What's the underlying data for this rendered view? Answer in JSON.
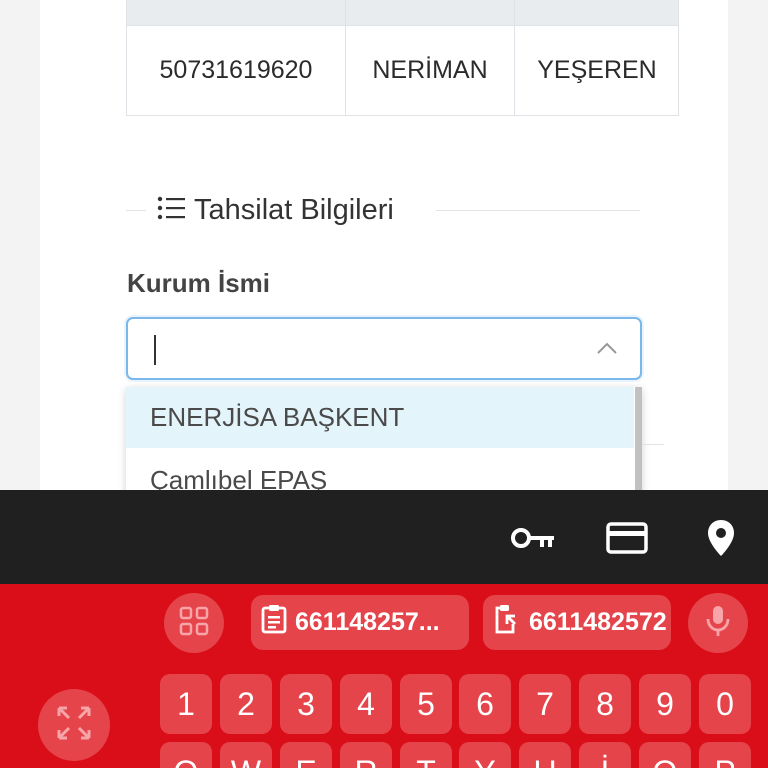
{
  "table": {
    "row": [
      "50731619620",
      "NERİMAN",
      "YEŞEREN"
    ]
  },
  "section": {
    "title": "Tahsilat Bilgileri",
    "icon": "list-icon"
  },
  "form": {
    "label": "Kurum İsmi",
    "value": "",
    "options": [
      "ENERJİSA BAŞKENT",
      "Çamlıbel EPAŞ"
    ],
    "highlighted_option": "ENERJİSA BAŞKENT"
  },
  "keyboard_toolbar": {
    "icons": [
      "key-icon",
      "credit-card-icon",
      "location-pin-icon"
    ]
  },
  "keyboard": {
    "clipboard": [
      "661148257...",
      "6611482572"
    ],
    "number_row": [
      "1",
      "2",
      "3",
      "4",
      "5",
      "6",
      "7",
      "8",
      "9",
      "0"
    ],
    "letter_row_partial": [
      "Q",
      "W",
      "E",
      "R",
      "T",
      "Y",
      "U",
      "İ",
      "O",
      "P"
    ],
    "accent_color": "#d90e19",
    "key_color": "#e5444a"
  }
}
